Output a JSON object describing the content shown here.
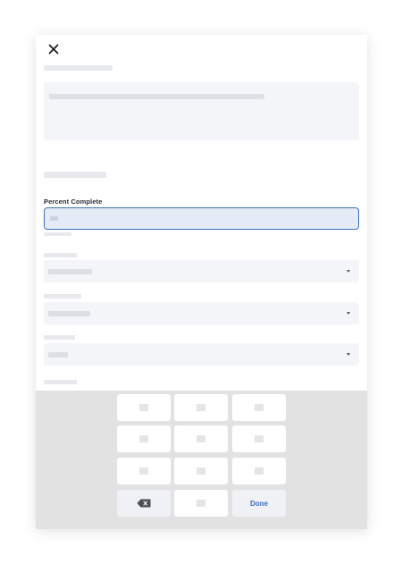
{
  "form": {
    "field_label": "Percent Complete",
    "close_icon": "close-icon"
  },
  "keypad": {
    "backspace_icon": "backspace-icon",
    "done_label": "Done"
  },
  "colors": {
    "accent": "#3f72b7",
    "active_input_bg": "#e4ebf6",
    "keypad_bg": "#e1e2e1",
    "done_text": "#3a6fc0"
  }
}
